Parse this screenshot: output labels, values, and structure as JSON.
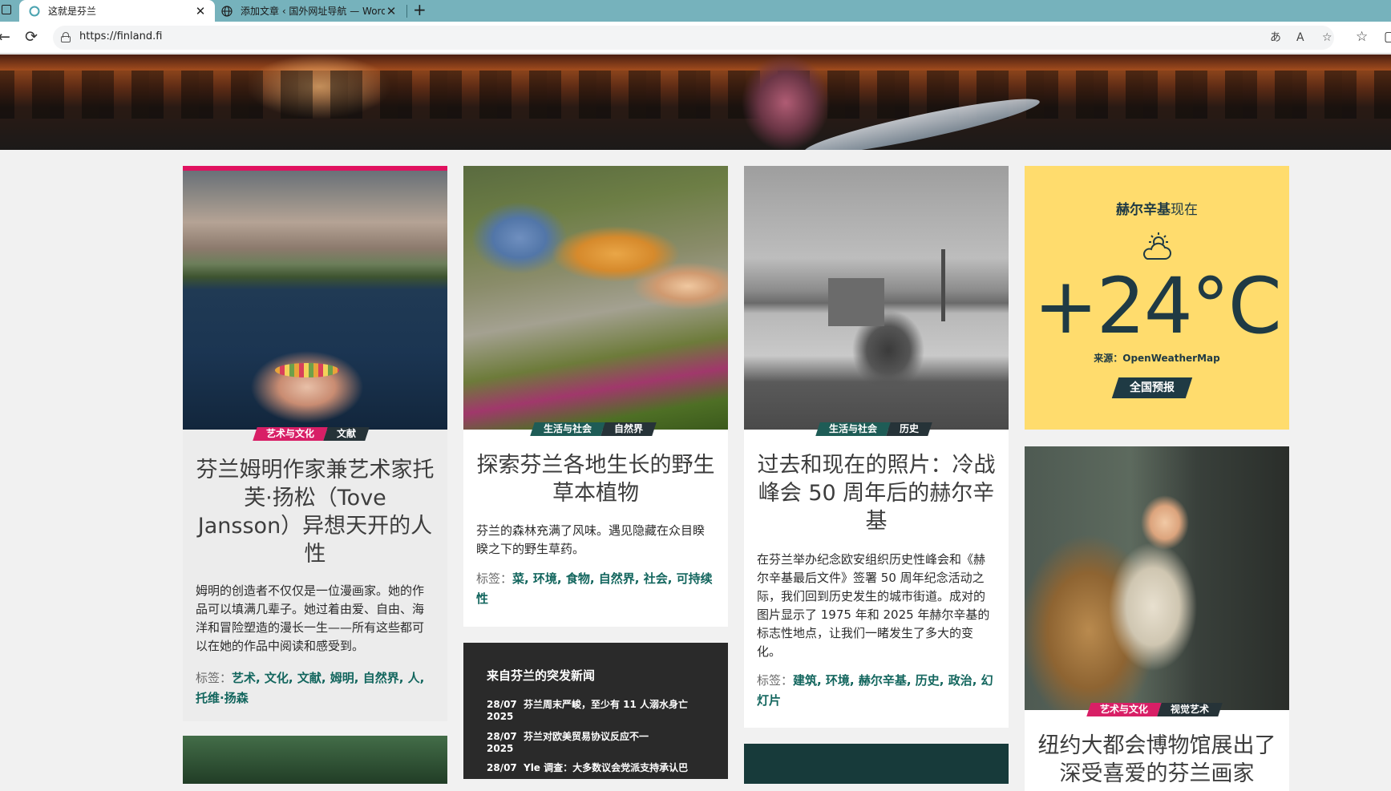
{
  "browser": {
    "tabs": [
      {
        "title": "这就是芬兰",
        "active": true,
        "icon": "finland-favicon"
      },
      {
        "title": "添加文章 ‹ 国外网址导航 — WordPress",
        "active": false,
        "icon": "globe-icon"
      }
    ],
    "url": "https://finland.fi"
  },
  "cards": [
    {
      "tags_chip": [
        "艺术与文化",
        "文献"
      ],
      "chip_colors": [
        "#d81f66",
        "#263338"
      ],
      "title": "芬兰姆明作家兼艺术家托芙·扬松（Tove Jansson）异想天开的人性",
      "desc": "姆明的创造者不仅仅是一位漫画家。她的作品可以填满几辈子。她过着由爱、自由、海洋和冒险塑造的漫长一生——所有这些都可以在她的作品中阅读和感受到。",
      "tags_label": "标签：",
      "tags": "艺术, 文化, 文献, 姆明, 自然界, 人, 托维·扬森"
    },
    {
      "tags_chip": [
        "生活与社会",
        "自然界"
      ],
      "chip_colors": [
        "#1e5c56",
        "#263338"
      ],
      "title": "探索芬兰各地生长的野生草本植物",
      "desc": "芬兰的森林充满了风味。遇见隐藏在众目睽睽之下的野生草药。",
      "tags_label": "标签：",
      "tags": "菜, 环境, 食物, 自然界, 社会, 可持续性"
    },
    {
      "tags_chip": [
        "生活与社会",
        "历史"
      ],
      "chip_colors": [
        "#1e5c56",
        "#263338"
      ],
      "title": "过去和现在的照片：冷战峰会 50 周年后的赫尔辛基",
      "desc": "在芬兰举办纪念欧安组织历史性峰会和《赫尔辛基最后文件》签署 50 周年纪念活动之际，我们回到历史发生的城市街道。成对的图片显示了 1975 年和 2025 年赫尔辛基的标志性地点，让我们一睹发生了多大的变化。",
      "tags_label": "标签：",
      "tags": "建筑, 环境, 赫尔辛基, 历史, 政治, 幻灯片"
    },
    {
      "tags_chip": [
        "艺术与文化",
        "视觉艺术"
      ],
      "chip_colors": [
        "#d81f66",
        "#263338"
      ],
      "title": "纽约大都会博物馆展出了深受喜爱的芬兰画家"
    }
  ],
  "weather": {
    "city": "赫尔辛基",
    "now": "现在",
    "temp": "+24°C",
    "source": "来源：OpenWeatherMap",
    "forecast_button": "全国预报",
    "icon": "partly-cloudy-icon",
    "bg_color": "#ffdc6d"
  },
  "news": {
    "title": "来自芬兰的突发新闻",
    "items": [
      {
        "date": "28/07 2025",
        "text": "芬兰周末严峻，至少有 11 人溺水身亡"
      },
      {
        "date": "28/07 2025",
        "text": "芬兰对欧美贸易协议反应不一"
      },
      {
        "date": "28/07",
        "text": "Yle 调查：大多数议会党派支持承认巴"
      }
    ]
  }
}
